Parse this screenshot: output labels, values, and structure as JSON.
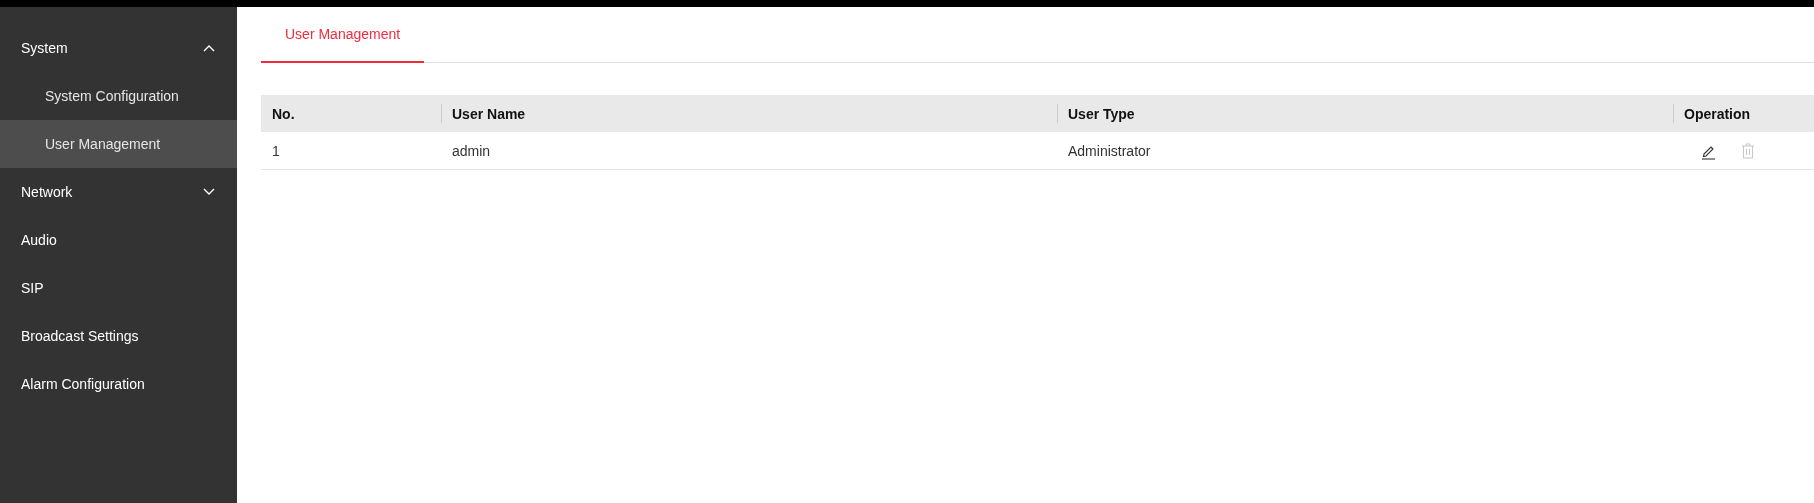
{
  "sidebar": {
    "items": [
      {
        "label": "System",
        "expanded": true,
        "children": [
          {
            "label": "System Configuration",
            "selected": false
          },
          {
            "label": "User Management",
            "selected": true
          }
        ]
      },
      {
        "label": "Network",
        "expanded": false
      },
      {
        "label": "Audio"
      },
      {
        "label": "SIP"
      },
      {
        "label": "Broadcast Settings"
      },
      {
        "label": "Alarm Configuration"
      }
    ]
  },
  "tabs": [
    {
      "label": "User Management",
      "selected": true
    }
  ],
  "table": {
    "columns": [
      "No.",
      "User Name",
      "User Type",
      "Operation"
    ],
    "rows": [
      {
        "cells": [
          "1",
          "admin",
          "Administrator"
        ],
        "edit_disabled": false,
        "delete_disabled": true
      }
    ]
  }
}
